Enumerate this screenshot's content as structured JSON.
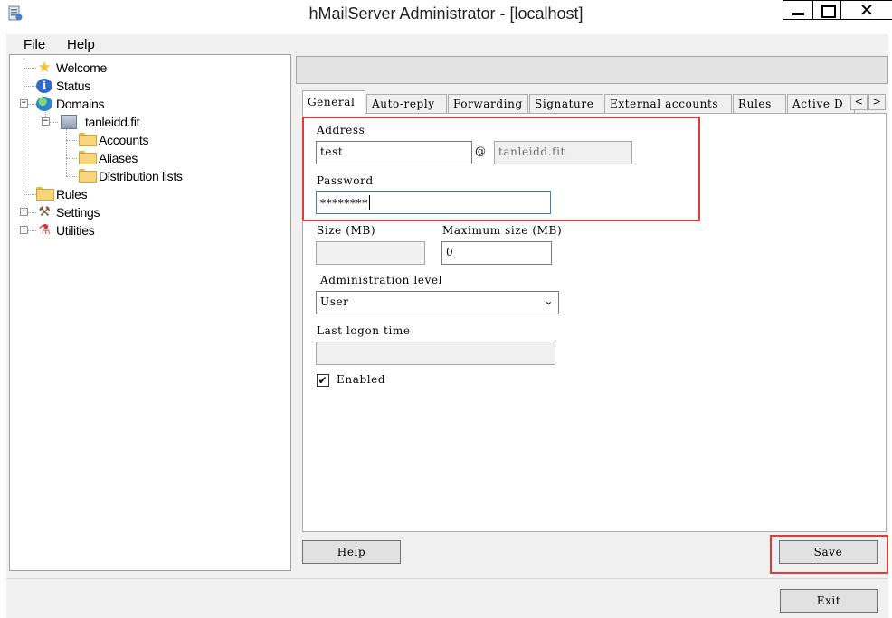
{
  "window": {
    "title": "hMailServer Administrator - [localhost]",
    "close_glyph": "✕"
  },
  "menu": {
    "items": [
      "File",
      "Help"
    ]
  },
  "tree": {
    "nodes": [
      {
        "label": "Welcome",
        "icon": "star-icon"
      },
      {
        "label": "Status",
        "icon": "info-icon"
      },
      {
        "label": "Domains",
        "icon": "globe-icon",
        "expander": "−"
      },
      {
        "label": "tanleidd.fit",
        "icon": "server-icon",
        "expander": "−"
      },
      {
        "label": "Accounts",
        "icon": "folder-icon"
      },
      {
        "label": "Aliases",
        "icon": "folder-icon"
      },
      {
        "label": "Distribution lists",
        "icon": "folder-icon"
      },
      {
        "label": "Rules",
        "icon": "folder-icon"
      },
      {
        "label": "Settings",
        "icon": "tools-icon",
        "expander": "+"
      },
      {
        "label": "Utilities",
        "icon": "utilities-icon",
        "expander": "+"
      }
    ]
  },
  "tabs": {
    "items": [
      "General",
      "Auto-reply",
      "Forwarding",
      "Signature",
      "External accounts",
      "Rules",
      "Active D"
    ],
    "active": "General",
    "scroll_left": "<",
    "scroll_right": ">"
  },
  "form": {
    "address_label": "Address",
    "address_value": "test",
    "at_sign": "@",
    "domain_value": "tanleidd.fit",
    "password_label": "Password",
    "password_value": "********",
    "size_label": "Size (MB)",
    "size_value": "",
    "max_size_label": "Maximum size (MB)",
    "max_size_value": "0",
    "admin_level_label": "Administration level",
    "admin_level_value": "User",
    "last_logon_label": "Last logon time",
    "last_logon_value": "",
    "enabled_label": "Enabled",
    "enabled_checked": true,
    "check_glyph": "✔"
  },
  "buttons": {
    "help_first": "H",
    "help_rest": "elp",
    "save_first": "S",
    "save_rest": "ave",
    "exit": "Exit"
  },
  "colors": {
    "highlight_red": "#e03a3a"
  }
}
